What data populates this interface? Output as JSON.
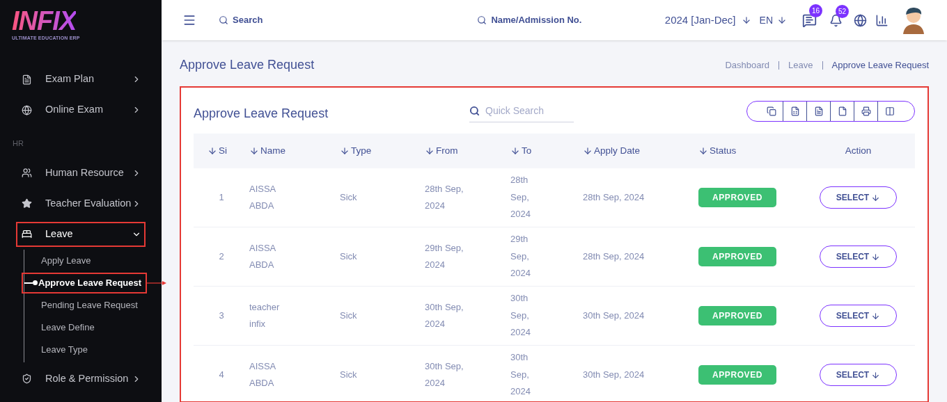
{
  "logo": {
    "name": "INFIX",
    "tagline": "ULTIMATE EDUCATION ERP"
  },
  "sidebar": {
    "items": [
      {
        "kind": "item",
        "label": "Exam Plan",
        "expanded": false,
        "highlighted": false
      },
      {
        "kind": "item",
        "label": "Online Exam",
        "expanded": false,
        "highlighted": false
      },
      {
        "kind": "section",
        "label": "HR"
      },
      {
        "kind": "item",
        "label": "Human Resource",
        "expanded": false,
        "highlighted": false
      },
      {
        "kind": "item",
        "label": "Teacher Evaluation",
        "expanded": false,
        "highlighted": false
      },
      {
        "kind": "item",
        "label": "Leave",
        "expanded": true,
        "highlighted": true,
        "children": [
          {
            "label": "Apply Leave",
            "selected": false,
            "highlighted": false
          },
          {
            "label": "Approve Leave Request",
            "selected": true,
            "highlighted": true
          },
          {
            "label": "Pending Leave Request",
            "selected": false,
            "highlighted": false
          },
          {
            "label": "Leave Define",
            "selected": false,
            "highlighted": false
          },
          {
            "label": "Leave Type",
            "selected": false,
            "highlighted": false
          }
        ]
      },
      {
        "kind": "item",
        "label": "Role & Permission",
        "expanded": false,
        "highlighted": false
      }
    ]
  },
  "topbar": {
    "search": "Search",
    "student_search": "Name/Admission No.",
    "session": "2024 [Jan-Dec]",
    "language": "EN",
    "messages": "16",
    "notifications": "52"
  },
  "page": {
    "title": "Approve Leave Request",
    "breadcrumb": [
      "Dashboard",
      "Leave",
      "Approve Leave Request"
    ]
  },
  "card": {
    "title": "Approve Leave Request",
    "highlighted": true,
    "search": {
      "placeholder": "Quick Search"
    },
    "columns": [
      "Si",
      "Name",
      "Type",
      "From",
      "To",
      "Apply Date",
      "Status",
      "Action"
    ],
    "rows": [
      {
        "si": "1",
        "name": "AISSA ABDA",
        "type": "Sick",
        "from": "28th Sep, 2024",
        "to": "28th Sep, 2024",
        "apply_date": "28th Sep, 2024",
        "status": "APPROVED",
        "action": "SELECT"
      },
      {
        "si": "2",
        "name": "AISSA ABDA",
        "type": "Sick",
        "from": "29th Sep, 2024",
        "to": "29th Sep, 2024",
        "apply_date": "28th Sep, 2024",
        "status": "APPROVED",
        "action": "SELECT"
      },
      {
        "si": "3",
        "name": "teacher infix",
        "type": "Sick",
        "from": "30th Sep, 2024",
        "to": "30th Sep, 2024",
        "apply_date": "30th Sep, 2024",
        "status": "APPROVED",
        "action": "SELECT"
      },
      {
        "si": "4",
        "name": "AISSA ABDA",
        "type": "Sick",
        "from": "30th Sep, 2024",
        "to": "30th Sep, 2024",
        "apply_date": "30th Sep, 2024",
        "status": "APPROVED",
        "action": "SELECT"
      }
    ]
  }
}
